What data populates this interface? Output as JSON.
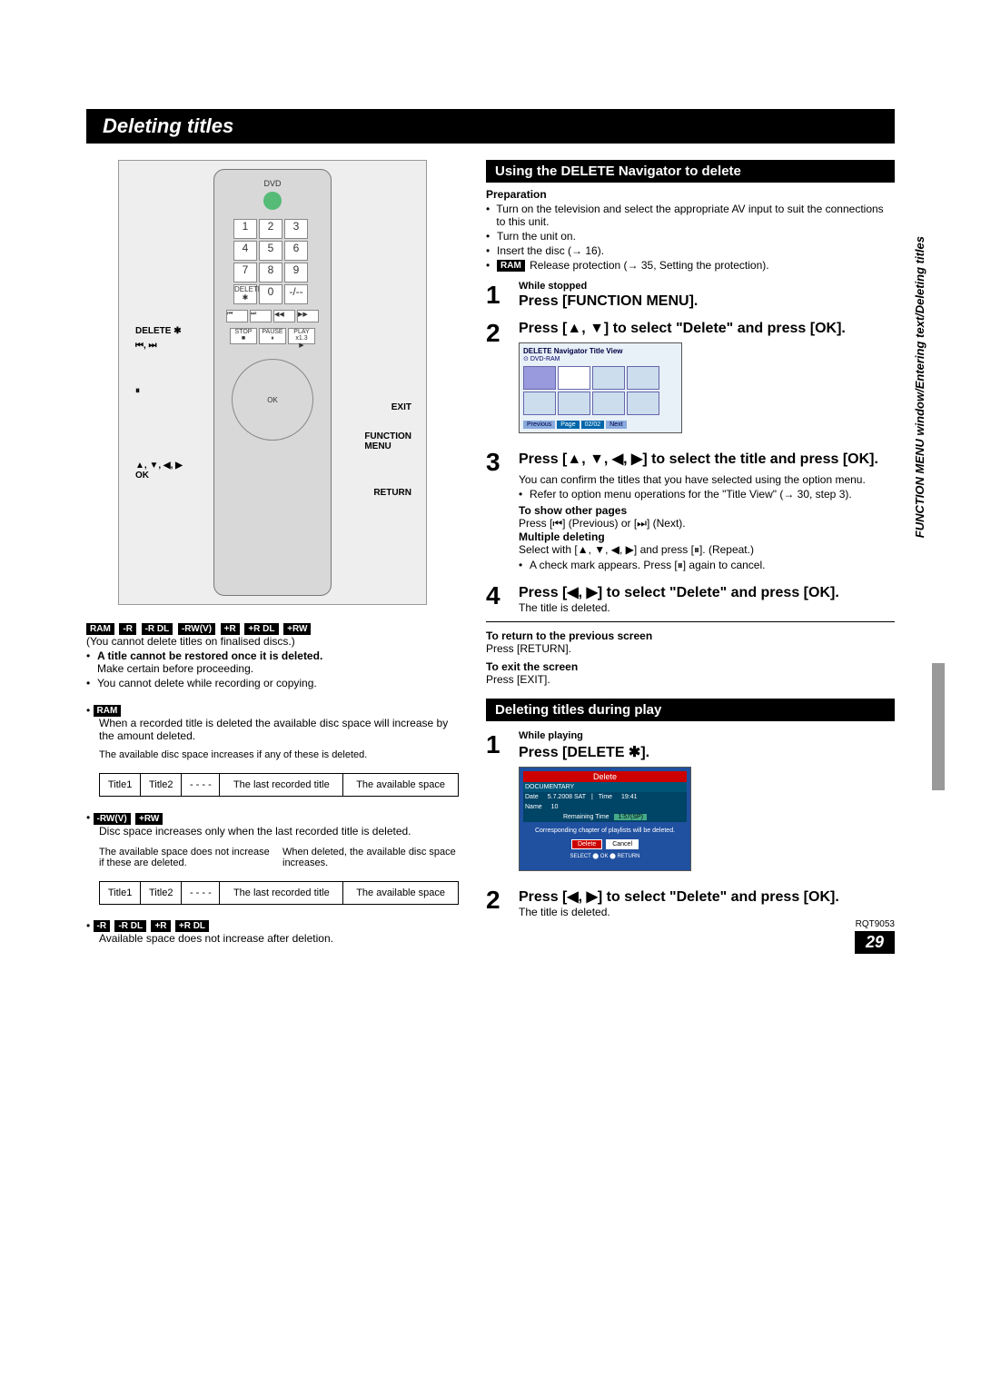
{
  "page": {
    "title": "Deleting titles",
    "sideTab": "FUNCTION MENU window/Entering text/Deleting titles",
    "rqt": "RQT9053",
    "pageNumber": "29"
  },
  "remote": {
    "labels": {
      "delete": "DELETE ✱",
      "skip": "⏮, ⏭",
      "pause": "⏸",
      "arrows": "▲, ▼, ◀, ▶\nOK",
      "exit": "EXIT",
      "funcMenu": "FUNCTION\nMENU",
      "return": "RETURN",
      "dvd": "DVD"
    }
  },
  "discBadges": {
    "set1": [
      "RAM",
      "-R",
      "-R DL",
      "-RW(V)",
      "+R",
      "+R DL",
      "+RW"
    ],
    "set2": [
      "RAM"
    ],
    "set3": [
      "-RW(V)",
      "+RW"
    ],
    "set4": [
      "-R",
      "-R DL",
      "+R",
      "+R DL"
    ],
    "ramInPrep": "RAM"
  },
  "leftCol": {
    "note1": "(You cannot delete titles on finalised discs.)",
    "bullet1": "A title cannot be restored once it is deleted.",
    "bullet1b": "Make certain before proceeding.",
    "bullet2": "You cannot delete while recording or copying.",
    "ramNote": "When a recorded title is deleted the available disc space will increase by the amount deleted.",
    "tableCaption1": "The available disc space increases if any of these is deleted.",
    "tableCells": {
      "t1": "Title1",
      "t2": "Title2",
      "dash": "- - - -",
      "last": "The last recorded title",
      "avail": "The available space"
    },
    "rwNote": "Disc space increases only when the last recorded title is deleted.",
    "boxLeft": "The available space does not increase if these are deleted.",
    "boxRight": "When deleted, the available disc space increases.",
    "rdlNote": "Available space does not increase after deletion."
  },
  "rightCol": {
    "section1": "Using the DELETE Navigator to delete",
    "prep": "Preparation",
    "prepB1": "Turn on the television and select the appropriate AV input to suit the connections to this unit.",
    "prepB2": "Turn the unit on.",
    "prepB3": "Insert the disc (→ 16).",
    "prepB4": " Release protection (→ 35, Setting the protection).",
    "step1sub": "While stopped",
    "step1": "Press [FUNCTION MENU].",
    "step2": "Press [▲, ▼] to select \"Delete\" and press [OK].",
    "navHeader": "DELETE Navigator   Title View",
    "navDisc": "DVD-RAM",
    "navPrev": "Previous",
    "navPage": "Page",
    "navPageNum": "02/02",
    "navNext": "Next",
    "step3": "Press [▲, ▼, ◀, ▶] to select the title and press [OK].",
    "step3n1": "You can confirm the titles that you have selected using the option menu.",
    "step3n2": "Refer to option menu operations for the \"Title View\" (→ 30, step 3).",
    "step3h1": "To show other pages",
    "step3h1b": "Press [⏮] (Previous) or [⏭] (Next).",
    "step3h2": "Multiple deleting",
    "step3h2b": "Select with [▲, ▼, ◀, ▶] and press [⏸]. (Repeat.)",
    "step3h2c": "A check mark appears. Press [⏸] again to cancel.",
    "step4": "Press [◀, ▶] to select \"Delete\" and press [OK].",
    "step4n": "The title is deleted.",
    "retTitle": "To return to the previous screen",
    "retBody": "Press [RETURN].",
    "exitTitle": "To exit the screen",
    "exitBody": "Press [EXIT].",
    "section2": "Deleting titles during play",
    "playStep1sub": "While playing",
    "playStep1": "Press [DELETE ✱].",
    "delDialog": {
      "title": "Delete",
      "doc": "DOCUMENTARY",
      "dateL": "Date",
      "date": "5.7.2008 SAT",
      "timeL": "Time",
      "time": "19:41",
      "nameL": "Name",
      "name": "10",
      "remain": "Remaining Time",
      "remainV": "1:57(SP)",
      "msg": "Corresponding chapter of playlists will be deleted.",
      "del": "Delete",
      "cancel": "Cancel",
      "sel": "SELECT",
      "ok": "OK",
      "ret": "RETURN"
    },
    "playStep2": "Press [◀, ▶] to select \"Delete\" and press [OK].",
    "playStep2n": "The title is deleted."
  }
}
